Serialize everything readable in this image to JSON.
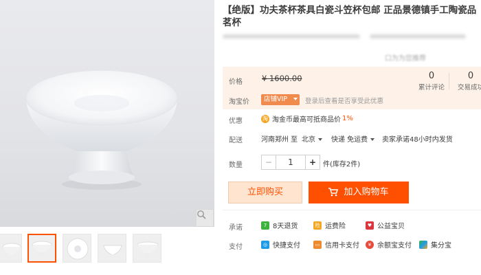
{
  "product": {
    "title": "【绝版】功夫茶杯茶具白瓷斗笠杯包邮 正品景德镇手工陶瓷品茗杯",
    "blurred_text": "口为为您推荐"
  },
  "price": {
    "label": "价格",
    "old_price": "¥ 1600.00",
    "taobao_label": "淘宝价",
    "vip_badge": "店铺VIP",
    "vip_note": "登录后查看是否享受此优惠"
  },
  "stats": {
    "reviews_count": "0",
    "reviews_label": "累计评论",
    "deals_count": "0",
    "deals_label": "交易成功"
  },
  "promo": {
    "label": "优惠",
    "coin": "淘",
    "text": "淘金币最高可抵商品价",
    "pct": "1%"
  },
  "shipping": {
    "label": "配送",
    "origin": "河南郑州 至",
    "dest": "北京",
    "method": "快递 免运费",
    "promise": "卖家承诺48小时内发货"
  },
  "quantity": {
    "label": "数量",
    "minus": "−",
    "value": "1",
    "plus": "+",
    "stock": "件(库存2件)"
  },
  "actions": {
    "buy_now": "立即购买",
    "add_to_cart": "加入购物车"
  },
  "promise": {
    "label": "承诺",
    "items": [
      "8天退货",
      "运费险",
      "公益宝贝"
    ]
  },
  "payment": {
    "label": "支付",
    "items": [
      "快捷支付",
      "信用卡支付",
      "余额宝支付",
      "集分宝"
    ]
  },
  "colors": {
    "accent": "#ff5000",
    "panel_bg": "#fdf1e8",
    "buy_bg": "#ffe4d0"
  },
  "icons": {
    "zoom": "magnifier-icon",
    "cart": "cart-icon",
    "return": "return-8day-icon",
    "insurance": "shipping-insurance-icon",
    "charity": "charity-icon",
    "quickpay": "quick-pay-icon",
    "creditcard": "credit-card-icon",
    "yuebao": "yuebao-icon",
    "jifenbao": "jifenbao-icon"
  }
}
